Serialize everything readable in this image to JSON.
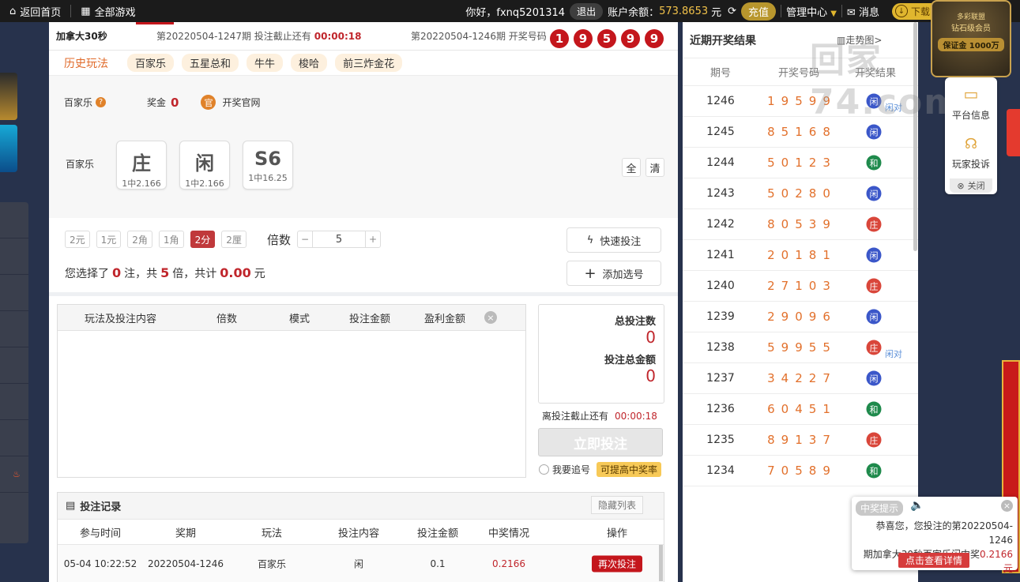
{
  "topbar": {
    "home": "返回首页",
    "all_games": "全部游戏",
    "greeting": "你好，fxnq5201314",
    "logout": "退出",
    "balance_label": "账户余额：",
    "balance_value": "573.8653",
    "balance_unit": "元",
    "recharge": "充值",
    "manage": "管理中心",
    "messages": "消息",
    "download": "下载中心"
  },
  "header": {
    "game_name": "加拿大30秒",
    "current_period": "第20220504-1247期 投注截止还有",
    "countdown": "00:00:18",
    "last_period": "第20220504-1246期 开奖号码",
    "balls": [
      "1",
      "9",
      "5",
      "9",
      "9"
    ]
  },
  "tabs": {
    "history": "历史玩法",
    "items": [
      "百家乐",
      "五星总和",
      "牛牛",
      "梭哈",
      "前三炸金花"
    ]
  },
  "info": {
    "game": "百家乐",
    "help": "?",
    "prize_label": "奖金",
    "prize_value": "0",
    "official_icon": "官",
    "official": "开奖官网"
  },
  "bets": {
    "label": "百家乐",
    "options": [
      {
        "name": "庄",
        "odds": "1中2.166"
      },
      {
        "name": "闲",
        "odds": "1中2.166"
      },
      {
        "name": "S6",
        "odds": "1中16.25"
      }
    ],
    "all": "全",
    "clear": "清"
  },
  "modes": [
    "2元",
    "1元",
    "2角",
    "1角",
    "2分",
    "2厘"
  ],
  "active_mode": "2分",
  "multiplier": {
    "label": "倍数",
    "minus": "−",
    "value": "5",
    "plus": "+"
  },
  "actions": {
    "quick": "快速投注",
    "add": "添加选号"
  },
  "summary": {
    "p1": "您选择了",
    "count": "0",
    "p2": "注，共",
    "times": "5",
    "p3": "倍，共计",
    "amount": "0.00",
    "p4": "元"
  },
  "cart": {
    "cols": [
      "玩法及投注内容",
      "倍数",
      "模式",
      "投注金额",
      "盈利金额"
    ]
  },
  "totals": {
    "count_label": "总投注数",
    "count": "0",
    "amount_label": "投注总金额",
    "amount": "0"
  },
  "deadline": {
    "label": "离投注截止还有",
    "value": "00:00:18"
  },
  "submit": "立即投注",
  "follow": {
    "label": "我要追号",
    "boost": "可提高中奖率"
  },
  "records": {
    "title": "投注记录",
    "hide": "隐藏列表",
    "cols": [
      "参与时间",
      "奖期",
      "玩法",
      "投注内容",
      "投注金额",
      "中奖情况",
      "操作"
    ],
    "rows": [
      {
        "time": "05-04 10:22:52",
        "period": "20220504-1246",
        "play": "百家乐",
        "content": "闲",
        "amount": "0.1",
        "win": "0.2166",
        "action": "再次投注"
      }
    ]
  },
  "results": {
    "title": "近期开奖结果",
    "trend": "走势图>",
    "cols": [
      "期号",
      "开奖号码",
      "开奖结果"
    ],
    "rows": [
      {
        "period": "1246",
        "nums": "19599",
        "res": "闲",
        "color": "#3b57c9",
        "pair": "闲对"
      },
      {
        "period": "1245",
        "nums": "85168",
        "res": "闲",
        "color": "#3b57c9",
        "pair": ""
      },
      {
        "period": "1244",
        "nums": "50123",
        "res": "和",
        "color": "#1f8a4c",
        "pair": ""
      },
      {
        "period": "1243",
        "nums": "50280",
        "res": "闲",
        "color": "#3b57c9",
        "pair": ""
      },
      {
        "period": "1242",
        "nums": "80539",
        "res": "庄",
        "color": "#d9463a",
        "pair": ""
      },
      {
        "period": "1241",
        "nums": "20181",
        "res": "闲",
        "color": "#3b57c9",
        "pair": ""
      },
      {
        "period": "1240",
        "nums": "27103",
        "res": "庄",
        "color": "#d9463a",
        "pair": ""
      },
      {
        "period": "1239",
        "nums": "29096",
        "res": "闲",
        "color": "#3b57c9",
        "pair": ""
      },
      {
        "period": "1238",
        "nums": "59955",
        "res": "庄",
        "color": "#d9463a",
        "pair": "闲对"
      },
      {
        "period": "1237",
        "nums": "34227",
        "res": "闲",
        "color": "#3b57c9",
        "pair": ""
      },
      {
        "period": "1236",
        "nums": "60451",
        "res": "和",
        "color": "#1f8a4c",
        "pair": ""
      },
      {
        "period": "1235",
        "nums": "89137",
        "res": "庄",
        "color": "#d9463a",
        "pair": ""
      },
      {
        "period": "1234",
        "nums": "70589",
        "res": "和",
        "color": "#1f8a4c",
        "pair": ""
      }
    ]
  },
  "vip": {
    "line1": "多彩联盟",
    "line2": "钻石级会员",
    "ribbon": "保证金 1000万"
  },
  "float": {
    "platform": "平台信息",
    "complaint": "玩家投诉",
    "close": "关闭"
  },
  "toast": {
    "tag": "中奖提示",
    "close": "×",
    "msg1": "恭喜您，您投注的第20220504-1246",
    "msg2": "期加拿大30秒百家乐闲中奖",
    "amount": "0.2166元",
    "button": "点击查看详情"
  },
  "watermark": "回家74.com"
}
